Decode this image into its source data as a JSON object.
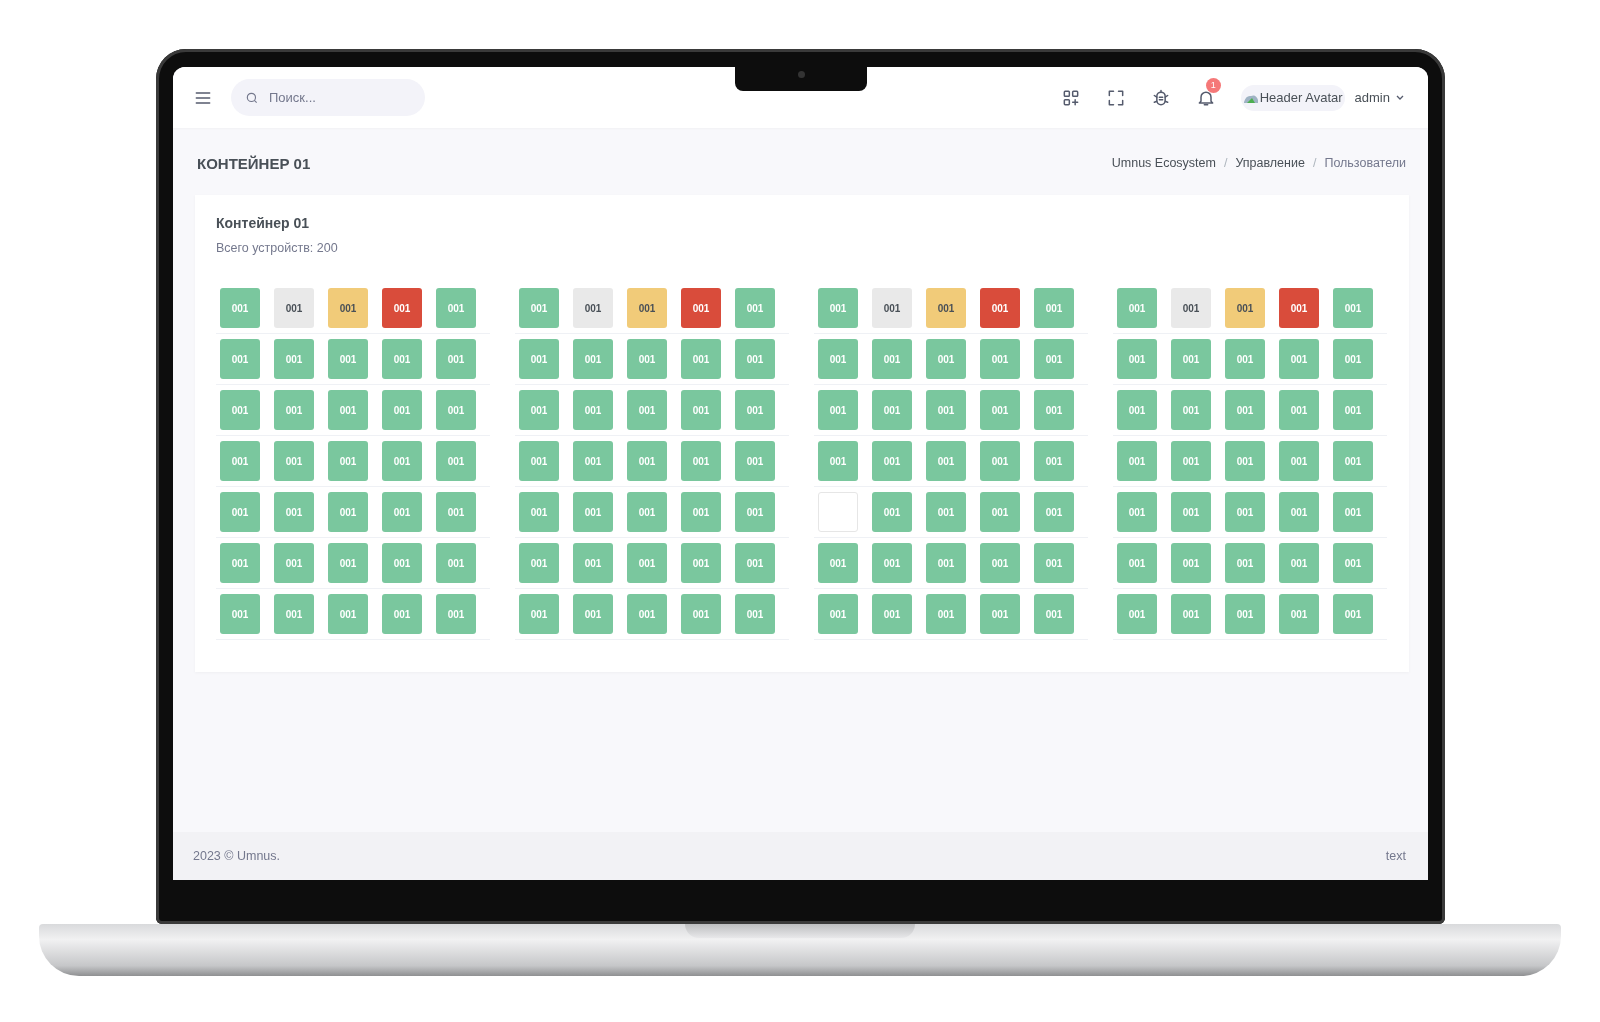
{
  "header": {
    "search": {
      "placeholder": "Поиск..."
    },
    "notifications": {
      "badge": "1"
    },
    "avatar": {
      "alt_text": "Header Avatar"
    },
    "user": {
      "name": "admin"
    }
  },
  "page_title": "КОНТЕЙНЕР 01",
  "breadcrumb": {
    "separator": "/",
    "items": [
      {
        "label": "Umnus Ecosystem",
        "active": false
      },
      {
        "label": "Управление",
        "active": false
      },
      {
        "label": "Пользователи",
        "active": true
      }
    ]
  },
  "card": {
    "title": "Контейнер 01",
    "subtitle": "Всего устройств: 200",
    "groups": [
      {
        "rows": [
          [
            {
              "label": "001",
              "kind": "ok"
            },
            {
              "label": "001",
              "kind": "offline"
            },
            {
              "label": "001",
              "kind": "warning"
            },
            {
              "label": "001",
              "kind": "alarm"
            },
            {
              "label": "001",
              "kind": "ok"
            }
          ],
          [
            {
              "label": "001",
              "kind": "ok"
            },
            {
              "label": "001",
              "kind": "ok"
            },
            {
              "label": "001",
              "kind": "ok"
            },
            {
              "label": "001",
              "kind": "ok"
            },
            {
              "label": "001",
              "kind": "ok"
            }
          ],
          [
            {
              "label": "001",
              "kind": "ok"
            },
            {
              "label": "001",
              "kind": "ok"
            },
            {
              "label": "001",
              "kind": "ok"
            },
            {
              "label": "001",
              "kind": "ok"
            },
            {
              "label": "001",
              "kind": "ok"
            }
          ],
          [
            {
              "label": "001",
              "kind": "ok"
            },
            {
              "label": "001",
              "kind": "ok"
            },
            {
              "label": "001",
              "kind": "ok"
            },
            {
              "label": "001",
              "kind": "ok"
            },
            {
              "label": "001",
              "kind": "ok"
            }
          ],
          [
            {
              "label": "001",
              "kind": "ok"
            },
            {
              "label": "001",
              "kind": "ok"
            },
            {
              "label": "001",
              "kind": "ok"
            },
            {
              "label": "001",
              "kind": "ok"
            },
            {
              "label": "001",
              "kind": "ok"
            }
          ],
          [
            {
              "label": "001",
              "kind": "ok"
            },
            {
              "label": "001",
              "kind": "ok"
            },
            {
              "label": "001",
              "kind": "ok"
            },
            {
              "label": "001",
              "kind": "ok"
            },
            {
              "label": "001",
              "kind": "ok"
            }
          ],
          [
            {
              "label": "001",
              "kind": "ok"
            },
            {
              "label": "001",
              "kind": "ok"
            },
            {
              "label": "001",
              "kind": "ok"
            },
            {
              "label": "001",
              "kind": "ok"
            },
            {
              "label": "001",
              "kind": "ok"
            }
          ]
        ]
      },
      {
        "rows": [
          [
            {
              "label": "001",
              "kind": "ok"
            },
            {
              "label": "001",
              "kind": "offline"
            },
            {
              "label": "001",
              "kind": "warning"
            },
            {
              "label": "001",
              "kind": "alarm"
            },
            {
              "label": "001",
              "kind": "ok"
            }
          ],
          [
            {
              "label": "001",
              "kind": "ok"
            },
            {
              "label": "001",
              "kind": "ok"
            },
            {
              "label": "001",
              "kind": "ok"
            },
            {
              "label": "001",
              "kind": "ok"
            },
            {
              "label": "001",
              "kind": "ok"
            }
          ],
          [
            {
              "label": "001",
              "kind": "ok"
            },
            {
              "label": "001",
              "kind": "ok"
            },
            {
              "label": "001",
              "kind": "ok"
            },
            {
              "label": "001",
              "kind": "ok"
            },
            {
              "label": "001",
              "kind": "ok"
            }
          ],
          [
            {
              "label": "001",
              "kind": "ok"
            },
            {
              "label": "001",
              "kind": "ok"
            },
            {
              "label": "001",
              "kind": "ok"
            },
            {
              "label": "001",
              "kind": "ok"
            },
            {
              "label": "001",
              "kind": "ok"
            }
          ],
          [
            {
              "label": "001",
              "kind": "ok"
            },
            {
              "label": "001",
              "kind": "ok"
            },
            {
              "label": "001",
              "kind": "ok"
            },
            {
              "label": "001",
              "kind": "ok"
            },
            {
              "label": "001",
              "kind": "ok"
            }
          ],
          [
            {
              "label": "001",
              "kind": "ok"
            },
            {
              "label": "001",
              "kind": "ok"
            },
            {
              "label": "001",
              "kind": "ok"
            },
            {
              "label": "001",
              "kind": "ok"
            },
            {
              "label": "001",
              "kind": "ok"
            }
          ],
          [
            {
              "label": "001",
              "kind": "ok"
            },
            {
              "label": "001",
              "kind": "ok"
            },
            {
              "label": "001",
              "kind": "ok"
            },
            {
              "label": "001",
              "kind": "ok"
            },
            {
              "label": "001",
              "kind": "ok"
            }
          ]
        ]
      },
      {
        "rows": [
          [
            {
              "label": "001",
              "kind": "ok"
            },
            {
              "label": "001",
              "kind": "offline"
            },
            {
              "label": "001",
              "kind": "warning"
            },
            {
              "label": "001",
              "kind": "alarm"
            },
            {
              "label": "001",
              "kind": "ok"
            }
          ],
          [
            {
              "label": "001",
              "kind": "ok"
            },
            {
              "label": "001",
              "kind": "ok"
            },
            {
              "label": "001",
              "kind": "ok"
            },
            {
              "label": "001",
              "kind": "ok"
            },
            {
              "label": "001",
              "kind": "ok"
            }
          ],
          [
            {
              "label": "001",
              "kind": "ok"
            },
            {
              "label": "001",
              "kind": "ok"
            },
            {
              "label": "001",
              "kind": "ok"
            },
            {
              "label": "001",
              "kind": "ok"
            },
            {
              "label": "001",
              "kind": "ok"
            }
          ],
          [
            {
              "label": "001",
              "kind": "ok"
            },
            {
              "label": "001",
              "kind": "ok"
            },
            {
              "label": "001",
              "kind": "ok"
            },
            {
              "label": "001",
              "kind": "ok"
            },
            {
              "label": "001",
              "kind": "ok"
            }
          ],
          [
            {
              "kind": "empty"
            },
            {
              "label": "001",
              "kind": "ok"
            },
            {
              "label": "001",
              "kind": "ok"
            },
            {
              "label": "001",
              "kind": "ok"
            },
            {
              "label": "001",
              "kind": "ok"
            }
          ],
          [
            {
              "label": "001",
              "kind": "ok"
            },
            {
              "label": "001",
              "kind": "ok"
            },
            {
              "label": "001",
              "kind": "ok"
            },
            {
              "label": "001",
              "kind": "ok"
            },
            {
              "label": "001",
              "kind": "ok"
            }
          ],
          [
            {
              "label": "001",
              "kind": "ok"
            },
            {
              "label": "001",
              "kind": "ok"
            },
            {
              "label": "001",
              "kind": "ok"
            },
            {
              "label": "001",
              "kind": "ok"
            },
            {
              "label": "001",
              "kind": "ok"
            }
          ]
        ]
      },
      {
        "rows": [
          [
            {
              "label": "001",
              "kind": "ok"
            },
            {
              "label": "001",
              "kind": "offline"
            },
            {
              "label": "001",
              "kind": "warning"
            },
            {
              "label": "001",
              "kind": "alarm"
            },
            {
              "label": "001",
              "kind": "ok"
            }
          ],
          [
            {
              "label": "001",
              "kind": "ok"
            },
            {
              "label": "001",
              "kind": "ok"
            },
            {
              "label": "001",
              "kind": "ok"
            },
            {
              "label": "001",
              "kind": "ok"
            },
            {
              "label": "001",
              "kind": "ok"
            }
          ],
          [
            {
              "label": "001",
              "kind": "ok"
            },
            {
              "label": "001",
              "kind": "ok"
            },
            {
              "label": "001",
              "kind": "ok"
            },
            {
              "label": "001",
              "kind": "ok"
            },
            {
              "label": "001",
              "kind": "ok"
            }
          ],
          [
            {
              "label": "001",
              "kind": "ok"
            },
            {
              "label": "001",
              "kind": "ok"
            },
            {
              "label": "001",
              "kind": "ok"
            },
            {
              "label": "001",
              "kind": "ok"
            },
            {
              "label": "001",
              "kind": "ok"
            }
          ],
          [
            {
              "label": "001",
              "kind": "ok"
            },
            {
              "label": "001",
              "kind": "ok"
            },
            {
              "label": "001",
              "kind": "ok"
            },
            {
              "label": "001",
              "kind": "ok"
            },
            {
              "label": "001",
              "kind": "ok"
            }
          ],
          [
            {
              "label": "001",
              "kind": "ok"
            },
            {
              "label": "001",
              "kind": "ok"
            },
            {
              "label": "001",
              "kind": "ok"
            },
            {
              "label": "001",
              "kind": "ok"
            },
            {
              "label": "001",
              "kind": "ok"
            }
          ],
          [
            {
              "label": "001",
              "kind": "ok"
            },
            {
              "label": "001",
              "kind": "ok"
            },
            {
              "label": "001",
              "kind": "ok"
            },
            {
              "label": "001",
              "kind": "ok"
            },
            {
              "label": "001",
              "kind": "ok"
            }
          ]
        ]
      }
    ]
  },
  "footer": {
    "left": "2023 © Umnus.",
    "right": "text"
  }
}
